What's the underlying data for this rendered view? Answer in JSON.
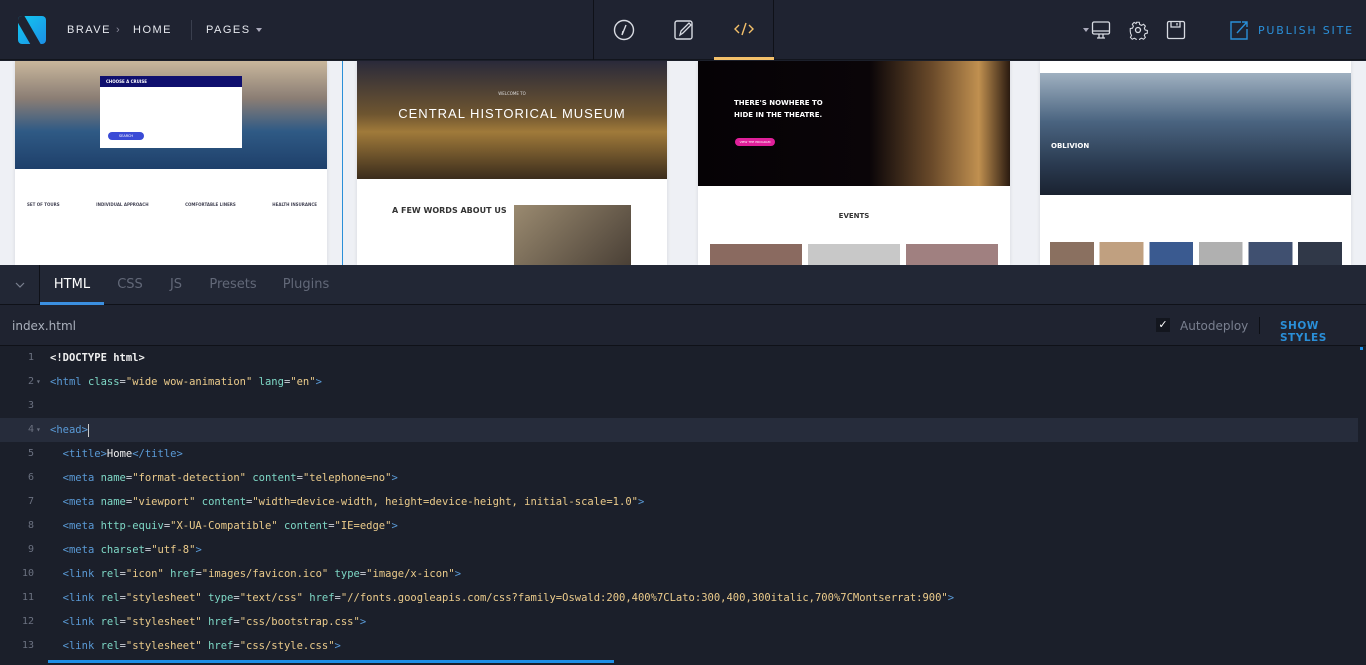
{
  "topbar": {
    "brand": "BRAVE",
    "crumb_sep": "›",
    "page": "HOME",
    "pages_label": "PAGES",
    "publish_label": "PUBLISH SITE",
    "modes": [
      "design-mode",
      "edit-mode",
      "code-mode"
    ],
    "active_mode": "code-mode"
  },
  "colors": {
    "accent": "#2a8fd8",
    "active_mode": "#f3c06a",
    "tab_active": "#3b8fe0"
  },
  "preview": {
    "cards": [
      {
        "hero_title": "CHOOSE A CRUISE",
        "button": "SEARCH",
        "features": [
          "SET OF TOURS",
          "INDIVIDUAL APPROACH",
          "COMFORTABLE LINERS",
          "HEALTH INSURANCE"
        ]
      },
      {
        "kicker": "WELCOME TO",
        "hero_title": "CENTRAL HISTORICAL MUSEUM",
        "section_title": "A FEW WORDS ABOUT US"
      },
      {
        "hero_title": "THERE'S NOWHERE TO HIDE IN THE THEATRE.",
        "button": "VIEW THE PROGRAM",
        "section_title": "EVENTS"
      },
      {
        "hero_title": "OBLIVION"
      }
    ]
  },
  "editor": {
    "tabs": [
      "HTML",
      "CSS",
      "JS",
      "Presets",
      "Plugins"
    ],
    "active_tab": 0,
    "file_name": "index.html",
    "autodeploy_label": "Autodeploy",
    "autodeploy_checked": true,
    "show_styles_label": "SHOW STYLES",
    "highlighted_line": 4,
    "lines": [
      {
        "n": "1",
        "fold": false,
        "tokens": [
          [
            "doc",
            "<!DOCTYPE html>"
          ]
        ]
      },
      {
        "n": "2",
        "fold": true,
        "tokens": [
          [
            "tag",
            "<html"
          ],
          [
            "pun",
            " "
          ],
          [
            "attr",
            "class"
          ],
          [
            "pun",
            "="
          ],
          [
            "str",
            "\"wide wow-animation\""
          ],
          [
            "pun",
            " "
          ],
          [
            "attr",
            "lang"
          ],
          [
            "pun",
            "="
          ],
          [
            "str",
            "\"en\""
          ],
          [
            "tag",
            ">"
          ]
        ]
      },
      {
        "n": "3",
        "fold": false,
        "tokens": []
      },
      {
        "n": "4",
        "fold": true,
        "tokens": [
          [
            "tag",
            "<head>"
          ]
        ]
      },
      {
        "n": "5",
        "fold": false,
        "tokens": [
          [
            "pun",
            "  "
          ],
          [
            "tag",
            "<title>"
          ],
          [
            "txt",
            "Home"
          ],
          [
            "tag",
            "</title>"
          ]
        ]
      },
      {
        "n": "6",
        "fold": false,
        "tokens": [
          [
            "pun",
            "  "
          ],
          [
            "tag",
            "<meta"
          ],
          [
            "pun",
            " "
          ],
          [
            "attr",
            "name"
          ],
          [
            "pun",
            "="
          ],
          [
            "str",
            "\"format-detection\""
          ],
          [
            "pun",
            " "
          ],
          [
            "attr",
            "content"
          ],
          [
            "pun",
            "="
          ],
          [
            "str",
            "\"telephone=no\""
          ],
          [
            "tag",
            ">"
          ]
        ]
      },
      {
        "n": "7",
        "fold": false,
        "tokens": [
          [
            "pun",
            "  "
          ],
          [
            "tag",
            "<meta"
          ],
          [
            "pun",
            " "
          ],
          [
            "attr",
            "name"
          ],
          [
            "pun",
            "="
          ],
          [
            "str",
            "\"viewport\""
          ],
          [
            "pun",
            " "
          ],
          [
            "attr",
            "content"
          ],
          [
            "pun",
            "="
          ],
          [
            "str",
            "\"width=device-width, height=device-height, initial-scale=1.0\""
          ],
          [
            "tag",
            ">"
          ]
        ]
      },
      {
        "n": "8",
        "fold": false,
        "tokens": [
          [
            "pun",
            "  "
          ],
          [
            "tag",
            "<meta"
          ],
          [
            "pun",
            " "
          ],
          [
            "attr",
            "http-equiv"
          ],
          [
            "pun",
            "="
          ],
          [
            "str",
            "\"X-UA-Compatible\""
          ],
          [
            "pun",
            " "
          ],
          [
            "attr",
            "content"
          ],
          [
            "pun",
            "="
          ],
          [
            "str",
            "\"IE=edge\""
          ],
          [
            "tag",
            ">"
          ]
        ]
      },
      {
        "n": "9",
        "fold": false,
        "tokens": [
          [
            "pun",
            "  "
          ],
          [
            "tag",
            "<meta"
          ],
          [
            "pun",
            " "
          ],
          [
            "attr",
            "charset"
          ],
          [
            "pun",
            "="
          ],
          [
            "str",
            "\"utf-8\""
          ],
          [
            "tag",
            ">"
          ]
        ]
      },
      {
        "n": "10",
        "fold": false,
        "tokens": [
          [
            "pun",
            "  "
          ],
          [
            "tag",
            "<link"
          ],
          [
            "pun",
            " "
          ],
          [
            "attr",
            "rel"
          ],
          [
            "pun",
            "="
          ],
          [
            "str",
            "\"icon\""
          ],
          [
            "pun",
            " "
          ],
          [
            "attr",
            "href"
          ],
          [
            "pun",
            "="
          ],
          [
            "str",
            "\"images/favicon.ico\""
          ],
          [
            "pun",
            " "
          ],
          [
            "attr",
            "type"
          ],
          [
            "pun",
            "="
          ],
          [
            "str",
            "\"image/x-icon\""
          ],
          [
            "tag",
            ">"
          ]
        ]
      },
      {
        "n": "11",
        "fold": false,
        "tokens": [
          [
            "pun",
            "  "
          ],
          [
            "tag",
            "<link"
          ],
          [
            "pun",
            " "
          ],
          [
            "attr",
            "rel"
          ],
          [
            "pun",
            "="
          ],
          [
            "str",
            "\"stylesheet\""
          ],
          [
            "pun",
            " "
          ],
          [
            "attr",
            "type"
          ],
          [
            "pun",
            "="
          ],
          [
            "str",
            "\"text/css\""
          ],
          [
            "pun",
            " "
          ],
          [
            "attr",
            "href"
          ],
          [
            "pun",
            "="
          ],
          [
            "str",
            "\"//fonts.googleapis.com/css?family=Oswald:200,400%7CLato:300,400,300italic,700%7CMontserrat:900\""
          ],
          [
            "tag",
            ">"
          ]
        ]
      },
      {
        "n": "12",
        "fold": false,
        "tokens": [
          [
            "pun",
            "  "
          ],
          [
            "tag",
            "<link"
          ],
          [
            "pun",
            " "
          ],
          [
            "attr",
            "rel"
          ],
          [
            "pun",
            "="
          ],
          [
            "str",
            "\"stylesheet\""
          ],
          [
            "pun",
            " "
          ],
          [
            "attr",
            "href"
          ],
          [
            "pun",
            "="
          ],
          [
            "str",
            "\"css/bootstrap.css\""
          ],
          [
            "tag",
            ">"
          ]
        ]
      },
      {
        "n": "13",
        "fold": false,
        "tokens": [
          [
            "pun",
            "  "
          ],
          [
            "tag",
            "<link"
          ],
          [
            "pun",
            " "
          ],
          [
            "attr",
            "rel"
          ],
          [
            "pun",
            "="
          ],
          [
            "str",
            "\"stylesheet\""
          ],
          [
            "pun",
            " "
          ],
          [
            "attr",
            "href"
          ],
          [
            "pun",
            "="
          ],
          [
            "str",
            "\"css/style.css\""
          ],
          [
            "tag",
            ">"
          ]
        ]
      }
    ]
  }
}
